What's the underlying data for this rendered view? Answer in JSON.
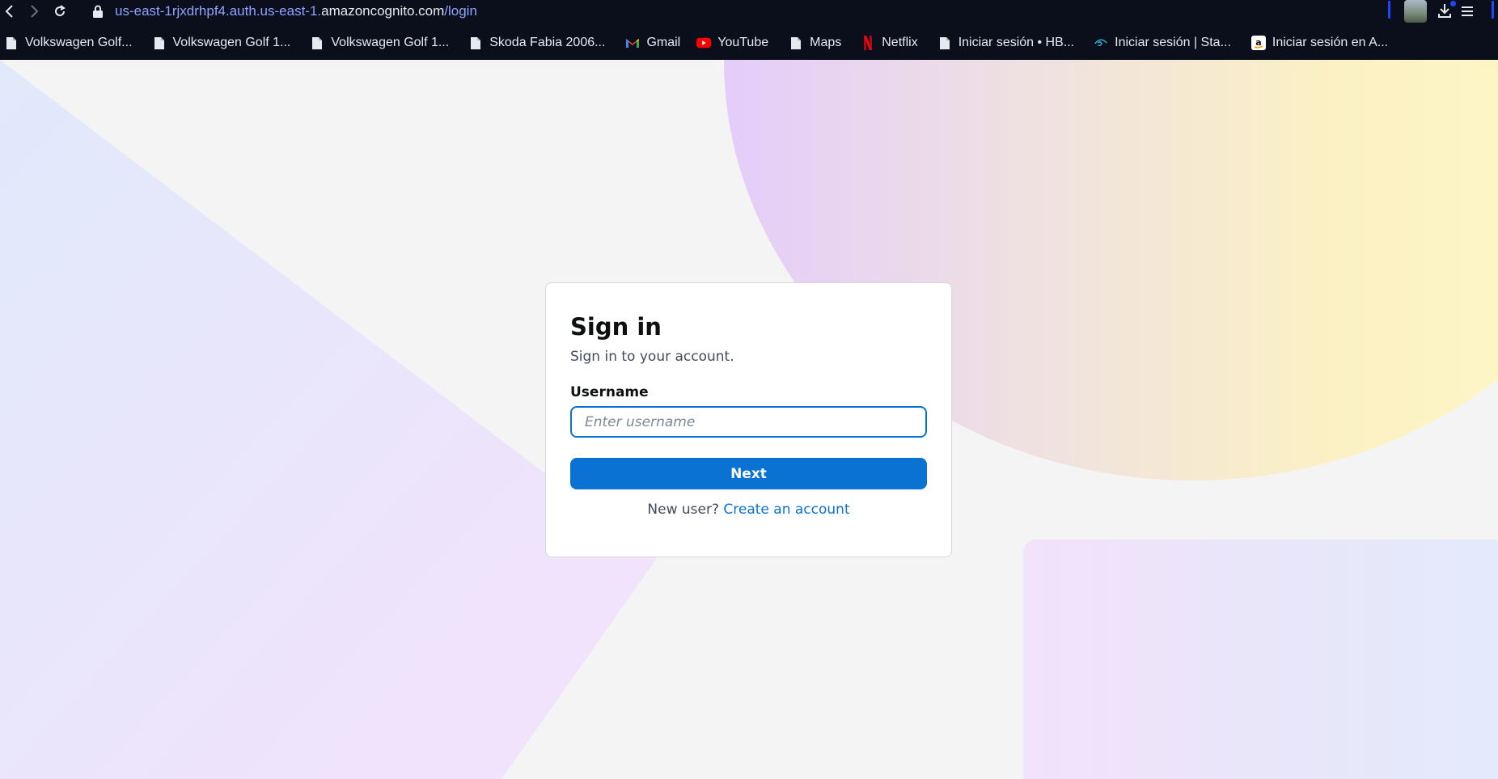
{
  "browser": {
    "url": {
      "prefix": "us-east-1rjxdrhpf4.auth.us-east-1.",
      "domain": "amazoncognito.com",
      "path": "/login"
    },
    "bookmarks": [
      {
        "label": "Volkswagen Golf...",
        "icon": "file-icon"
      },
      {
        "label": "Volkswagen Golf 1...",
        "icon": "file-icon"
      },
      {
        "label": "Volkswagen Golf 1...",
        "icon": "file-icon"
      },
      {
        "label": "Skoda Fabia 2006...",
        "icon": "file-icon"
      },
      {
        "label": "Gmail",
        "icon": "gmail-icon"
      },
      {
        "label": "YouTube",
        "icon": "youtube-icon"
      },
      {
        "label": "Maps",
        "icon": "file-icon"
      },
      {
        "label": "Netflix",
        "icon": "netflix-icon"
      },
      {
        "label": "Iniciar sesión • HB...",
        "icon": "file-icon"
      },
      {
        "label": "Iniciar sesión | Sta...",
        "icon": "disney-icon"
      },
      {
        "label": "Iniciar sesión en A...",
        "icon": "amazon-icon"
      }
    ]
  },
  "signin": {
    "title": "Sign in",
    "subtitle": "Sign in to your account.",
    "username_label": "Username",
    "username_placeholder": "Enter username",
    "username_value": "",
    "next_label": "Next",
    "new_user_text": "New user?",
    "create_account_label": "Create an account"
  },
  "colors": {
    "primary": "#0972d3",
    "chrome_bg": "#0b0f1c",
    "page_bg": "#f4f4f4"
  }
}
